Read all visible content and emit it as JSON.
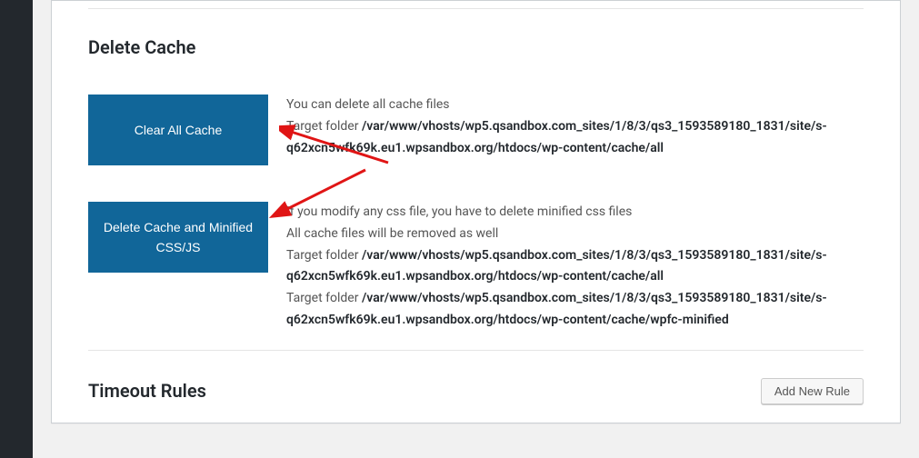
{
  "sections": {
    "delete_cache": {
      "title": "Delete Cache",
      "clear_all": {
        "button_label": "Clear All Cache",
        "desc_line1": "You can delete all cache files",
        "target_label": "Target folder ",
        "target_path": "/var/www/vhosts/wp5.qsandbox.com_sites/1/8/3/qs3_1593589180_1831/site/s-q62xcn5wfk69k.eu1.wpsandbox.org/htdocs/wp-content/cache/all"
      },
      "delete_minified": {
        "button_label": "Delete Cache and Minified CSS/JS",
        "desc_line1": "If you modify any css file, you have to delete minified css files",
        "desc_line2": "All cache files will be removed as well",
        "target_label1": "Target folder ",
        "target_path1": "/var/www/vhosts/wp5.qsandbox.com_sites/1/8/3/qs3_1593589180_1831/site/s-q62xcn5wfk69k.eu1.wpsandbox.org/htdocs/wp-content/cache/all",
        "target_label2": "Target folder ",
        "target_path2": "/var/www/vhosts/wp5.qsandbox.com_sites/1/8/3/qs3_1593589180_1831/site/s-q62xcn5wfk69k.eu1.wpsandbox.org/htdocs/wp-content/cache/wpfc-minified"
      }
    },
    "timeout_rules": {
      "title": "Timeout Rules",
      "add_button_label": "Add New Rule"
    }
  }
}
